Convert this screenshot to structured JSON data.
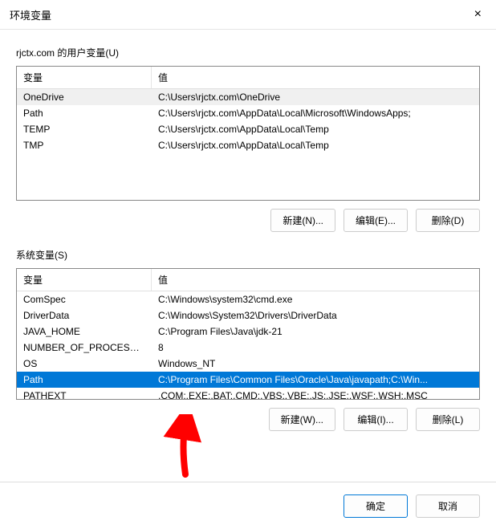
{
  "dialog": {
    "title": "环境变量",
    "close_icon": "×"
  },
  "user_section": {
    "label": "rjctx.com 的用户变量(U)",
    "header_name": "变量",
    "header_value": "值",
    "rows": [
      {
        "name": "OneDrive",
        "value": "C:\\Users\\rjctx.com\\OneDrive"
      },
      {
        "name": "Path",
        "value": "C:\\Users\\rjctx.com\\AppData\\Local\\Microsoft\\WindowsApps;"
      },
      {
        "name": "TEMP",
        "value": "C:\\Users\\rjctx.com\\AppData\\Local\\Temp"
      },
      {
        "name": "TMP",
        "value": "C:\\Users\\rjctx.com\\AppData\\Local\\Temp"
      }
    ],
    "buttons": {
      "new": "新建(N)...",
      "edit": "编辑(E)...",
      "delete": "删除(D)"
    }
  },
  "system_section": {
    "label": "系统变量(S)",
    "header_name": "变量",
    "header_value": "值",
    "rows": [
      {
        "name": "ComSpec",
        "value": "C:\\Windows\\system32\\cmd.exe"
      },
      {
        "name": "DriverData",
        "value": "C:\\Windows\\System32\\Drivers\\DriverData"
      },
      {
        "name": "JAVA_HOME",
        "value": "C:\\Program Files\\Java\\jdk-21"
      },
      {
        "name": "NUMBER_OF_PROCESSORS",
        "value": "8"
      },
      {
        "name": "OS",
        "value": "Windows_NT"
      },
      {
        "name": "Path",
        "value": "C:\\Program Files\\Common Files\\Oracle\\Java\\javapath;C:\\Win..."
      },
      {
        "name": "PATHEXT",
        "value": ".COM;.EXE;.BAT;.CMD;.VBS;.VBE;.JS;.JSE;.WSF;.WSH;.MSC"
      }
    ],
    "buttons": {
      "new": "新建(W)...",
      "edit": "编辑(I)...",
      "delete": "删除(L)"
    }
  },
  "dialog_buttons": {
    "ok": "确定",
    "cancel": "取消"
  },
  "colors": {
    "selection": "#0078d7",
    "arrow": "#ff0000"
  }
}
